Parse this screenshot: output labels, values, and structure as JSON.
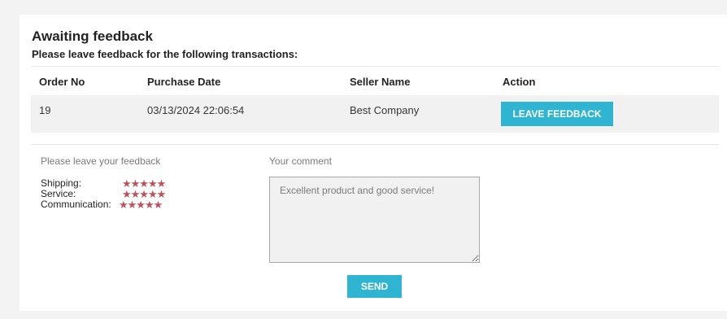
{
  "section": {
    "title": "Awaiting feedback",
    "subtitle": "Please leave feedback for the following transactions:"
  },
  "table": {
    "headers": [
      "Order No",
      "Purchase Date",
      "Seller Name",
      "Action"
    ],
    "rows": [
      {
        "order_no": "19",
        "purchase_date": "03/13/2024 22:06:54",
        "seller_name": "Best Company",
        "action_label": "LEAVE FEEDBACK"
      }
    ]
  },
  "feedback": {
    "ratings_label": "Please leave your feedback",
    "comment_label": "Your comment",
    "ratings": [
      {
        "name": "Shipping:",
        "stars": "★★★★★",
        "value": 5,
        "max": 5
      },
      {
        "name": "Service:",
        "stars": "★★★★★",
        "value": 5,
        "max": 5
      },
      {
        "name": "Communication:",
        "stars": "★★★★★",
        "value": 5,
        "max": 5
      }
    ],
    "comment_value": "Excellent product and good service!",
    "send_label": "SEND"
  },
  "colors": {
    "accent": "#2fb5d2",
    "star": "#c0505a",
    "row_bg": "#f1f1f1"
  }
}
